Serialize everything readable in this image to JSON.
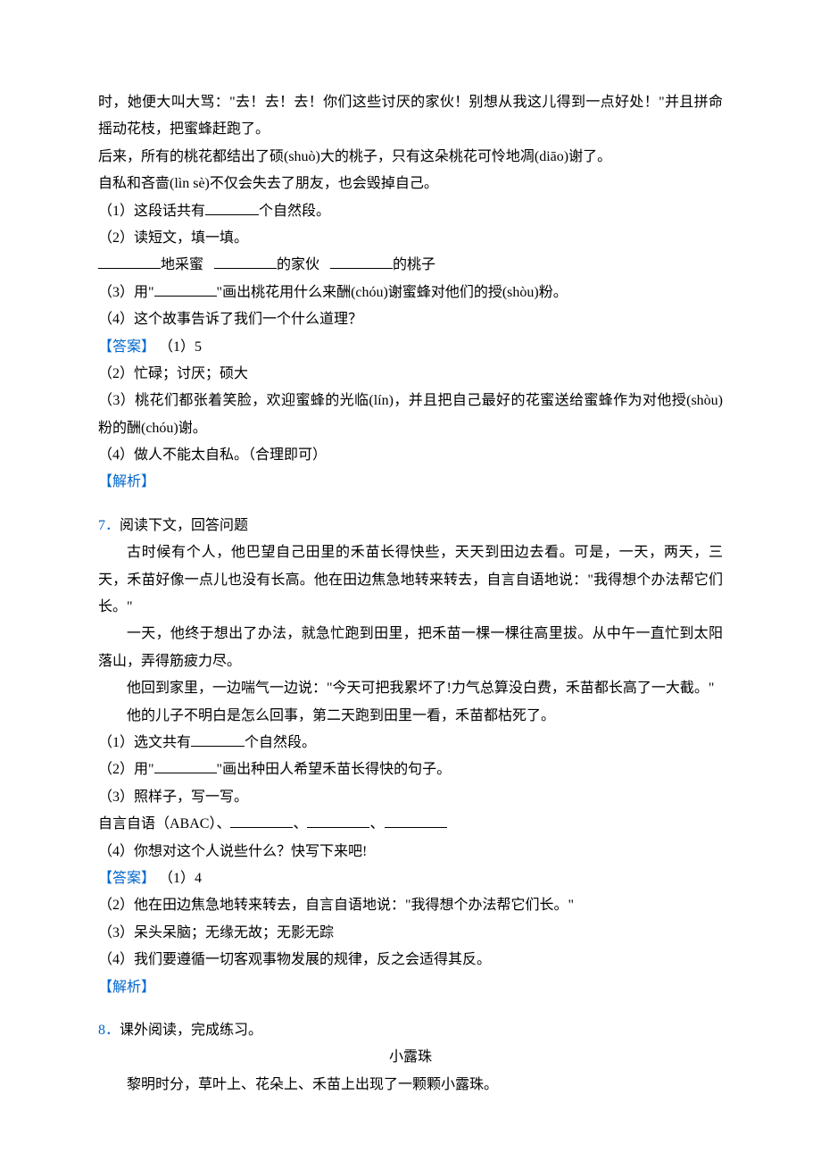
{
  "q6": {
    "p1": "时，她便大叫大骂：\"去！去！去！你们这些讨厌的家伙！别想从我这儿得到一点好处！\"并且拼命摇动花枝，把蜜蜂赶跑了。",
    "p2": "后来，所有的桃花都结出了硕(shuò)大的桃子，只有这朵桃花可怜地凋(diāo)谢了。",
    "p3": "自私和吝啬(lìn sè)不仅会失去了朋友，也会毁掉自己。",
    "s1a": "（1）这段话共有",
    "s1b": "个自然段。",
    "s2": "（2）读短文，填一填。",
    "s2a": "地采蜜",
    "s2b": "的家伙",
    "s2c": "的桃子",
    "s3a": "（3）用\"",
    "s3b": "\"画出桃花用什么来酬(chóu)谢蜜蜂对他们的授(shòu)粉。",
    "s4": "（4）这个故事告诉了我们一个什么道理？",
    "answerLabel": "【答案】",
    "a1": "（1）5",
    "a2": "（2）忙碌；讨厌；硕大",
    "a3": "（3）桃花们都张着笑脸，欢迎蜜蜂的光临(lín)，并且把自己最好的花蜜送给蜜蜂作为对他授(shòu)粉的酬(chóu)谢。",
    "a4": "（4）做人不能太自私。（合理即可）",
    "analysisLabel": "【解析】"
  },
  "q7": {
    "num": "7．",
    "title": "阅读下文，回答问题",
    "p1": "古时候有个人，他巴望自己田里的禾苗长得快些，天天到田边去看。可是，一天，两天，三天，禾苗好像一点儿也没有长高。他在田边焦急地转来转去，自言自语地说：\"我得想个办法帮它们长。\"",
    "p2": "一天，他终于想出了办法，就急忙跑到田里，把禾苗一棵一棵往高里拔。从中午一直忙到太阳落山，弄得筋疲力尽。",
    "p3": "他回到家里，一边喘气一边说：\"今天可把我累坏了!力气总算没白费，禾苗都长高了一大截。\"",
    "p4": "他的儿子不明白是怎么回事，第二天跑到田里一看，禾苗都枯死了。",
    "s1a": "（1）选文共有",
    "s1b": "个自然段。",
    "s2a": "（2）用\"",
    "s2b": "\"画出种田人希望禾苗长得快的句子。",
    "s3": "（3）照样子，写一写。",
    "s3a": "自言自语（ABAC）、",
    "sep": "、",
    "s4": "（4）你想对这个人说些什么？快写下来吧!",
    "answerLabel": "【答案】",
    "a1": "（1）4",
    "a2": "（2）他在田边焦急地转来转去，自言自语地说：\"我得想个办法帮它们长。\"",
    "a3": "（3）呆头呆脑；无缘无故；无影无踪",
    "a4": "（4）我们要遵循一切客观事物发展的规律，反之会适得其反。",
    "analysisLabel": "【解析】"
  },
  "q8": {
    "num": "8．",
    "title": "课外阅读，完成练习。",
    "storyTitle": "小露珠",
    "p1": "黎明时分，草叶上、花朵上、禾苗上出现了一颗颗小露珠。"
  }
}
